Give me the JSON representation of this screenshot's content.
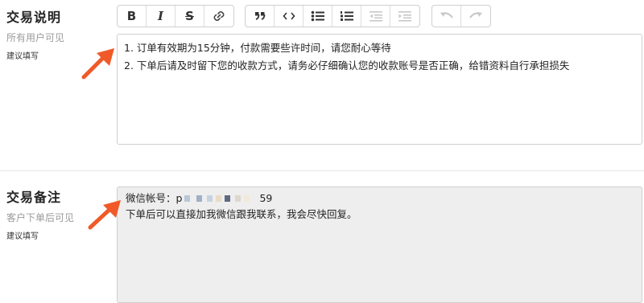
{
  "trade_desc": {
    "title": "交易说明",
    "subtitle": "所有用户可见",
    "hint": "建议填写",
    "lines": [
      "1. 订单有效期为15分钟，付款需要些许时间，请您耐心等待",
      "2. 下单后请及时留下您的收款方式，请务必仔细确认您的收款账号是否正确，给错资料自行承担损失"
    ]
  },
  "toolbar": {
    "buttons": [
      {
        "name": "bold-icon",
        "glyph": "B"
      },
      {
        "name": "italic-icon",
        "glyph": "I"
      },
      {
        "name": "strikethrough-icon",
        "glyph": "S"
      },
      {
        "name": "link-icon",
        "glyph": ""
      },
      {
        "name": "quote-icon",
        "glyph": "❞"
      },
      {
        "name": "code-icon",
        "glyph": "<>"
      },
      {
        "name": "bulleted-list-icon",
        "glyph": ""
      },
      {
        "name": "numbered-list-icon",
        "glyph": ""
      },
      {
        "name": "outdent-icon",
        "glyph": ""
      },
      {
        "name": "indent-icon",
        "glyph": ""
      },
      {
        "name": "undo-icon",
        "glyph": ""
      },
      {
        "name": "redo-icon",
        "glyph": ""
      }
    ]
  },
  "trade_note": {
    "title": "交易备注",
    "subtitle": "客户下单后可见",
    "hint": "建议填写",
    "wechat_label": "微信帐号：p",
    "wechat_suffix": "59",
    "line2": "下单后可以直接加我微信跟我联系，我会尽快回复。"
  },
  "colors": {
    "arrow": "#f05a28",
    "editor_bg": "#ffffff",
    "note_bg": "#eeeeee",
    "border": "#cfcfcf"
  }
}
